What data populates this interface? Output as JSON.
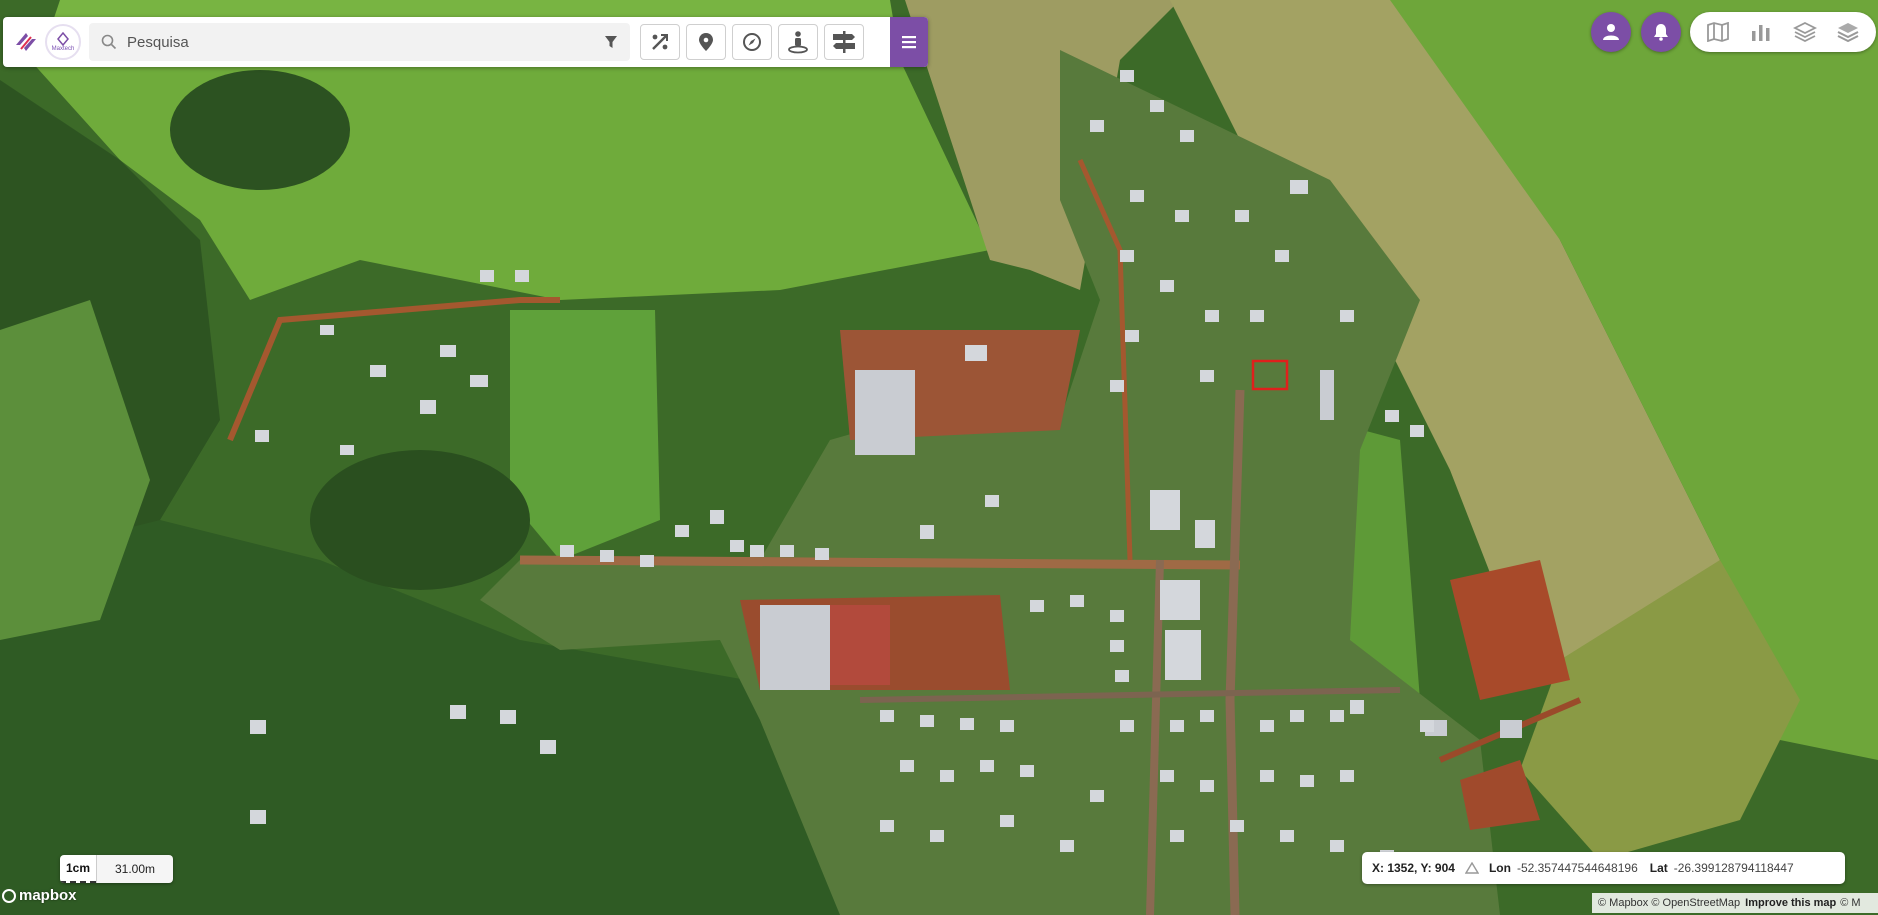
{
  "search": {
    "placeholder": "Pesquisa"
  },
  "branding": {
    "logo_caption": "Maxtech"
  },
  "toolbar": {
    "tools": [
      {
        "name": "measure-tool-icon"
      },
      {
        "name": "location-pin-icon"
      },
      {
        "name": "compass-icon"
      },
      {
        "name": "street-view-icon"
      },
      {
        "name": "signpost-icon"
      }
    ],
    "menu_icon": "hamburger-menu-icon"
  },
  "topright": {
    "user_icon": "user-icon",
    "notifications_icon": "bell-icon",
    "layers": [
      "map-icon",
      "bar-chart-icon",
      "layers-outline-icon",
      "layers-filled-icon"
    ]
  },
  "scale": {
    "unit": "1cm",
    "distance": "31.00m"
  },
  "coords": {
    "xy_label": "X: 1352, Y: 904",
    "lon_label": "Lon",
    "lon_value": "-52.357447544648196",
    "lat_label": "Lat",
    "lat_value": "-26.399128794118447"
  },
  "map": {
    "provider_logo": "mapbox",
    "attribution": "© Mapbox © OpenStreetMap",
    "improve": "Improve this map",
    "attribution_tail": "© M"
  },
  "colors": {
    "accent": "#7c4ea6",
    "field_green": "#6fae3a",
    "forest_green": "#2f5a22",
    "dry_field": "#9c9a5a",
    "dirt_road": "#a85a35",
    "selection": "#e0201c"
  }
}
